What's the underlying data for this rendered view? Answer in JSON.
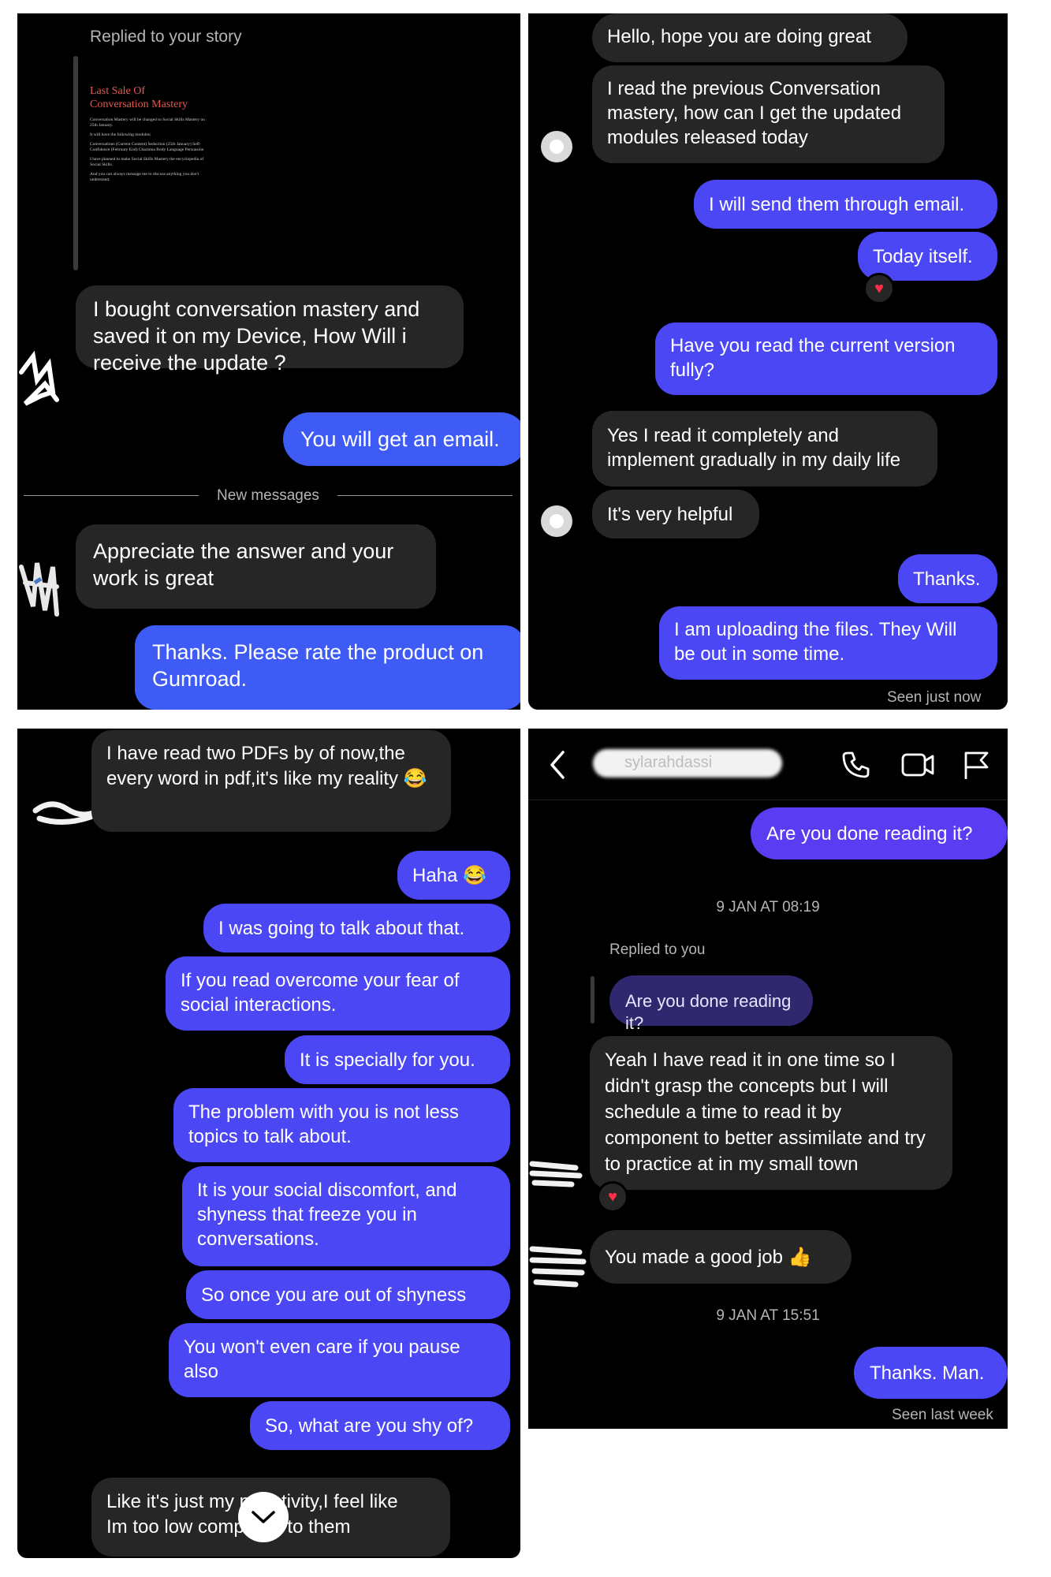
{
  "panel1": {
    "replied_label": "Replied to your story",
    "story": {
      "title_line1": "Last Sale Of",
      "title_line2": "Conversation Mastery",
      "para1": "Conversation Mastery will be changed to Social Skills Mastery on 25th January.",
      "para2": "It will have the following modules:",
      "modules": "Conversations (Current Content) Seduction (25th January) Self-Confidence (February End) Charisma Body Language Persuasion",
      "para3": "I have planned to make Social Skills Mastery the encyclopedia of Social Skills.",
      "para4": "And you can always message me to discuss anything you don't understand."
    },
    "msg1": "I bought conversation mastery and saved it on my Device, How Will i receive the update ?",
    "msg2": "You will get an email.",
    "divider": "New messages",
    "msg3": "Appreciate the answer and your work is great",
    "msg4": "Thanks. Please rate the product on Gumroad."
  },
  "panel2": {
    "msg1": "Hello, hope you are doing great",
    "msg2": "I read the previous Conversation mastery, how can I get the updated modules released today",
    "msg3": "I will send them through email.",
    "msg4": "Today itself.",
    "msg5": "Have you read the current version fully?",
    "msg6": "Yes I read it completely and implement gradually in my daily life",
    "msg7": "It's very helpful",
    "msg8": "Thanks.",
    "msg9": "I am uploading the files. They Will be out in some time.",
    "seen": "Seen just now"
  },
  "panel3": {
    "msg1": "I have read two PDFs by of now,the every word in pdf,it's like my reality 😂",
    "msg2": "Haha 😂",
    "msg3": "I was going to talk about that.",
    "msg4": "If you read overcome your fear of social interactions.",
    "msg5": "It is specially for you.",
    "msg6": "The problem with you is not less topics to talk about.",
    "msg7": "It is your social discomfort, and shyness that freeze you in conversations.",
    "msg8": "So once you are out of shyness",
    "msg9": "You won't even care if you pause also",
    "msg10": "So, what are you shy of?",
    "msg11_line1": "Like it's just my negativity,I feel like",
    "msg11_line2": "Im too low compared to them"
  },
  "panel4": {
    "header_name": "sylarahdassi",
    "msg1": "Are you done reading it?",
    "time1": "9 JAN AT 08:19",
    "replied_label": "Replied to you",
    "quoted": "Are you done reading it?",
    "msg2": "Yeah I have read it in one time so I didn't grasp the concepts but I will schedule a time to read it by component to better assimilate and try to practice at in my small town",
    "msg3": "You made a good job 👍",
    "time2": "9 JAN AT 15:51",
    "msg4": "Thanks. Man.",
    "seen": "Seen last week"
  },
  "colors": {
    "panel_bg": "#000000",
    "incoming": "#262626",
    "outgoing_start": "#5b35f5",
    "outgoing_end": "#3d5cf5",
    "heart": "#ff2d4a"
  },
  "icons": [
    "back-chevron-icon",
    "phone-icon",
    "video-icon",
    "flag-icon",
    "heart-reaction-icon",
    "scroll-down-chevron-icon"
  ]
}
